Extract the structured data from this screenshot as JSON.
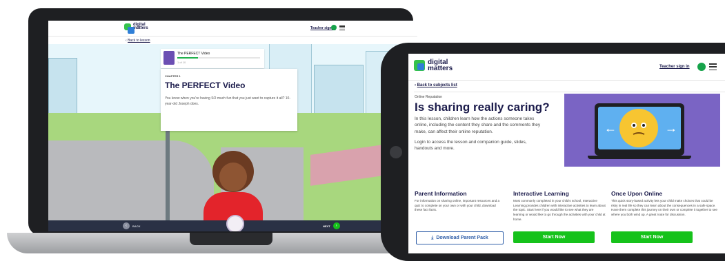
{
  "brand": {
    "line1": "digital",
    "line2": "matters"
  },
  "laptop": {
    "teacher_link": "Teacher sign in",
    "back_link": "Back to lesson",
    "video_title": "The PERFECT Video",
    "video_meta": "1 of 10",
    "chapter": "CHAPTER 1",
    "heading": "The PERFECT Video",
    "body": "You know when you're having SO much fun that you just want to capture it all? 10-year-old Joseph does.",
    "nav_back": "BACK",
    "nav_next": "NEXT",
    "progress": 0.25
  },
  "tablet": {
    "teacher_link": "Teacher sign in",
    "back_link": "Back to subjects list",
    "eyebrow": "Online Reputation",
    "title": "Is sharing really caring?",
    "intro": "In this lesson, children learn how the actions someone takes online, including the content they share and the comments they make, can affect their online reputation.",
    "login_text": "Login to access the lesson and companion guide, slides, handouts and more.",
    "columns": [
      {
        "title": "Parent Information",
        "body": "For information on sharing online, important resources and a quiz to complete on your own or with your child, download these fact facts.",
        "button": "Download Parent Pack"
      },
      {
        "title": "Interactive Learning",
        "body": "Most commonly completed in your child's school, Interactive Learning provides children with interactive activities to learn about the topic. Start here if you would like to see what they are learning or would like to go through the activities with your child at home.",
        "button": "Start Now"
      },
      {
        "title": "Once Upon Online",
        "body": "This quick story-based activity lets your child make choices that could be risky in real life so they can learn about the consequences in a safe space. Have them complete this journey on their own or complete it together to see where you both wind up. A great route for discussion.",
        "button": "Start Now"
      }
    ]
  },
  "colors": {
    "accent_green": "#16c21b",
    "brand_navy": "#1b1b4b",
    "hero_purple": "#7a64c4",
    "footer_navy": "#2a3145"
  },
  "icons": [
    "user-icon",
    "hamburger-icon",
    "chevron-left-icon",
    "chevron-right-icon",
    "download-icon",
    "thinking-emoji-icon",
    "arrow-left-icon",
    "arrow-right-icon"
  ]
}
